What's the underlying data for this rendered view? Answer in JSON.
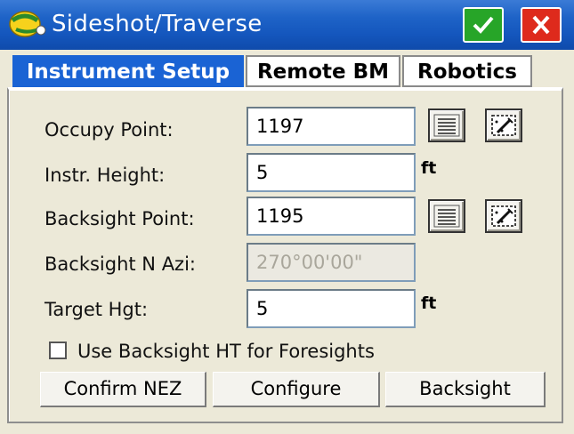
{
  "window": {
    "title": "Sideshot/Traverse",
    "ok_icon": "checkmark-icon",
    "close_icon": "close-icon",
    "colors": {
      "titlebar": "#1a5ec8",
      "ok": "#27a528",
      "close": "#de2a1c",
      "active_tab": "#1a63d4"
    }
  },
  "tabs": [
    {
      "label": "Instrument Setup",
      "active": true
    },
    {
      "label": "Remote BM",
      "active": false
    },
    {
      "label": "Robotics",
      "active": false
    }
  ],
  "form": {
    "occupy_point": {
      "label": "Occupy Point:",
      "value": "1197"
    },
    "instr_height": {
      "label": "Instr. Height:",
      "value": "5",
      "unit": "ft"
    },
    "backsight_point": {
      "label": "Backsight Point:",
      "value": "1195"
    },
    "backsight_azi": {
      "label": "Backsight N Azi:",
      "value": "270°00'00\""
    },
    "target_hgt": {
      "label": "Target Hgt:",
      "value": "5",
      "unit": "ft"
    },
    "use_backsight_ht": {
      "label": "Use Backsight HT for Foresights",
      "checked": false
    }
  },
  "buttons": {
    "confirm": "Confirm NEZ",
    "configure": "Configure",
    "backsight": "Backsight"
  }
}
